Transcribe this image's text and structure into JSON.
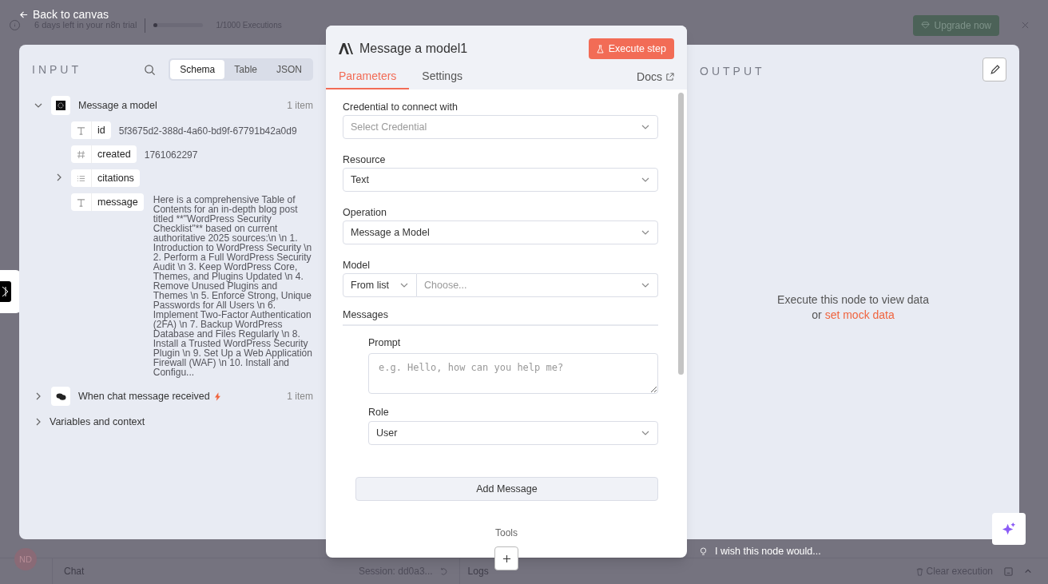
{
  "trial_bar": {
    "trial_text": "6 days left in your n8n trial",
    "executions": "1/1000 Executions",
    "level": 0.03,
    "upgrade_button": "Upgrade now"
  },
  "back_link": "Back to canvas",
  "input_panel": {
    "title": "INPUT",
    "view_tabs": [
      {
        "label": "Schema",
        "selected": true
      },
      {
        "label": "Table",
        "selected": false
      },
      {
        "label": "JSON",
        "selected": false
      }
    ],
    "nodes": [
      {
        "name": "Message a model",
        "count": "1 item",
        "expanded": true,
        "kind": "model",
        "trigger": false,
        "fields": [
          {
            "kind": "string",
            "key": "id",
            "value": "5f3675d2-388d-4a60-bd9f-67791b42a0d9"
          },
          {
            "kind": "number",
            "key": "created",
            "value": "1761062297"
          },
          {
            "kind": "array",
            "key": "citations",
            "expanded": false
          },
          {
            "kind": "string",
            "key": "message",
            "value": "Here is a comprehensive Table of Contents for an in-depth blog post titled **\"WordPress Security Checklist\"** based on current authoritative 2025 sources:\\n \\n 1. Introduction to WordPress Security \\n 2. Perform a Full WordPress Security Audit \\n 3. Keep WordPress Core, Themes, and Plugins Updated \\n 4. Remove Unused Plugins and Themes \\n 5. Enforce Strong, Unique Passwords for All Users \\n 6. Implement Two-Factor Authentication (2FA) \\n 7. Backup WordPress Database and Files Regularly \\n 8. Install a Trusted WordPress Security Plugin \\n 9. Set Up a Web Application Firewall (WAF) \\n 10. Install and Configu..."
          }
        ]
      },
      {
        "name": "When chat message received",
        "count": "1 item",
        "expanded": false,
        "kind": "chat",
        "trigger": true
      }
    ],
    "variables": "Variables and context"
  },
  "node_panel": {
    "title": "Message a model1",
    "execute_button": "Execute step",
    "tabs": [
      {
        "label": "Parameters",
        "selected": true
      },
      {
        "label": "Settings",
        "selected": false
      }
    ],
    "docs_link": "Docs",
    "parameters": [
      {
        "kind": "select",
        "label": "Credential to connect with",
        "placeholder": "Select Credential"
      },
      {
        "kind": "select",
        "label": "Resource",
        "value": "Text"
      },
      {
        "kind": "select",
        "label": "Operation",
        "value": "Message a Model"
      },
      {
        "kind": "model",
        "label": "Model",
        "mode": "From list",
        "placeholder": "Choose..."
      }
    ],
    "messages": {
      "label": "Messages",
      "prompt_label": "Prompt",
      "prompt_placeholder": "e.g. Hello, how can you help me?",
      "role_label": "Role",
      "role": "User",
      "add_button": "Add Message"
    },
    "tools_label": "Tools"
  },
  "output_panel": {
    "title": "OUTPUT",
    "empty_text": "Execute this node to view data",
    "or_text": "or",
    "mock_link": "set mock data"
  },
  "feedback": "I wish this node would...",
  "bottom_bar": {
    "avatar": "ND",
    "chat": "Chat",
    "session": "Session: dd0a3...",
    "logs": "Logs",
    "clear": "Clear execution"
  }
}
